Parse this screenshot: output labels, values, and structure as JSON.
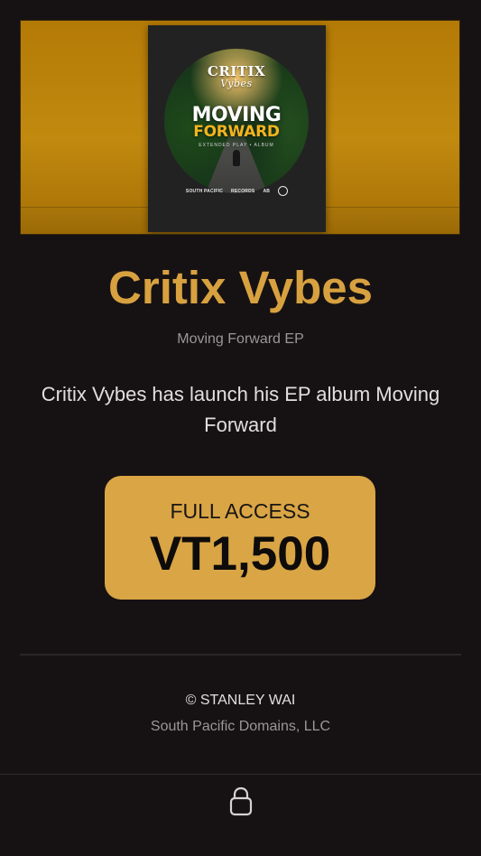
{
  "cover": {
    "brand": "CRITIX",
    "brand_sub": "Vybes",
    "title_top": "MOVING",
    "title_bottom": "FORWARD",
    "tagline": "EXTENDED PLAY • ALBUM",
    "logos": [
      "SOUTH PACIFIC",
      "RECORDS",
      "AB"
    ]
  },
  "header": {
    "artist": "Critix Vybes",
    "subtitle": "Moving Forward EP"
  },
  "main": {
    "description": "Critix Vybes has launch his EP album Moving Forward"
  },
  "pricing": {
    "label": "FULL ACCESS",
    "price": "VT1,500"
  },
  "footer": {
    "copyright": "© STANLEY WAI",
    "company": "South Pacific Domains, LLC"
  },
  "bottom_bar": {
    "icon": "lock-icon"
  },
  "colors": {
    "background": "#161213",
    "accent": "#d8a140",
    "button": "#d9a545",
    "hero": "#c18a0f"
  }
}
